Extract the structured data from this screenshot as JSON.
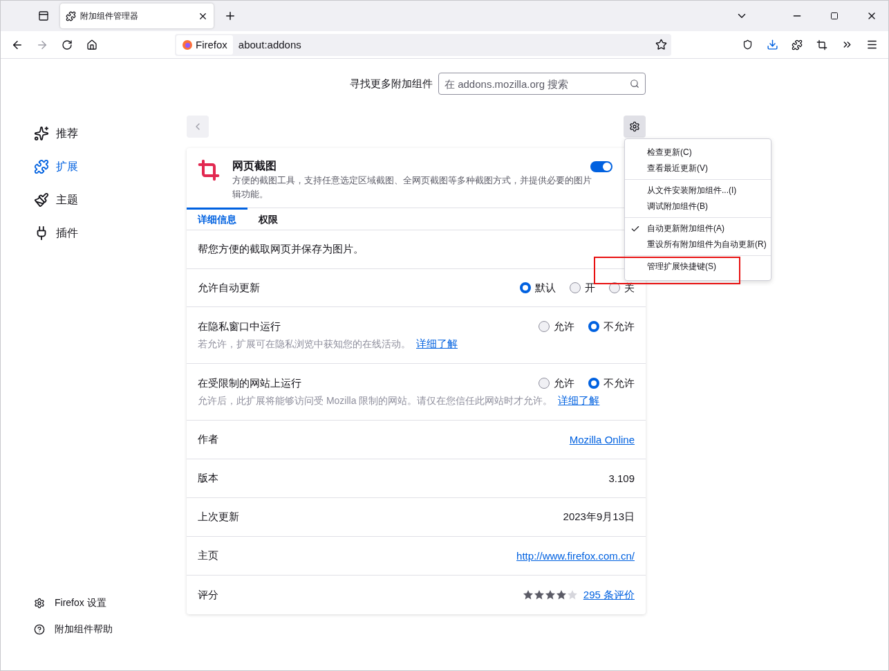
{
  "browser": {
    "tab_title": "附加组件管理器",
    "identity_label": "Firefox",
    "url": "about:addons"
  },
  "search": {
    "label": "寻找更多附加组件",
    "placeholder": "在 addons.mozilla.org 搜索"
  },
  "sidebar": {
    "items": [
      {
        "label": "推荐",
        "selected": false
      },
      {
        "label": "扩展",
        "selected": true
      },
      {
        "label": "主题",
        "selected": false
      },
      {
        "label": "插件",
        "selected": false
      }
    ],
    "footer": [
      "Firefox 设置",
      "附加组件帮助"
    ]
  },
  "addon": {
    "name": "网页截图",
    "enabled": true,
    "description_lines": [
      "方便的截图工具，支持任意选定区域截图、全网页截图等多种截图方式，并提供必要的图片",
      "辑功能。"
    ],
    "tabs": [
      {
        "label": "详细信息",
        "selected": true
      },
      {
        "label": "权限",
        "selected": false
      }
    ],
    "rows": [
      {
        "kind": "text",
        "text": "帮您方便的截取网页并保存为图片。"
      },
      {
        "kind": "radios",
        "label": "允许自动更新",
        "options": [
          {
            "label": "默认",
            "selected": true
          },
          {
            "label": "开",
            "selected": false
          },
          {
            "label": "关",
            "selected": false
          }
        ]
      },
      {
        "kind": "radios",
        "label": "在隐私窗口中运行",
        "note": "若允许，扩展可在隐私浏览中获知您的在线活动。",
        "link": "详细了解",
        "options": [
          {
            "label": "允许",
            "selected": false
          },
          {
            "label": "不允许",
            "selected": true
          }
        ]
      },
      {
        "kind": "radios",
        "label": "在受限制的网站上运行",
        "note": "允许后，此扩展将能够访问受 Mozilla 限制的网站。请仅在您信任此网站时才允许。",
        "link": "详细了解",
        "options": [
          {
            "label": "允许",
            "selected": false
          },
          {
            "label": "不允许",
            "selected": true
          }
        ]
      },
      {
        "kind": "link",
        "label": "作者",
        "value": "Mozilla Online"
      },
      {
        "kind": "info",
        "label": "版本",
        "value": "3.109"
      },
      {
        "kind": "info",
        "label": "上次更新",
        "value": "2023年9月13日"
      },
      {
        "kind": "link",
        "label": "主页",
        "value": "http://www.firefox.com.cn/"
      },
      {
        "kind": "rating",
        "label": "评分",
        "stars": 4,
        "value": "295 条评价"
      }
    ]
  },
  "menu": {
    "groups": [
      [
        {
          "label": "检查更新(C)",
          "checked": false
        },
        {
          "label": "查看最近更新(V)",
          "checked": false
        }
      ],
      [
        {
          "label": "从文件安装附加组件...(I)",
          "checked": false
        },
        {
          "label": "调试附加组件(B)",
          "checked": false
        }
      ],
      [
        {
          "label": "自动更新附加组件(A)",
          "checked": true
        },
        {
          "label": "重设所有附加组件为自动更新(R)",
          "checked": false
        }
      ],
      [
        {
          "label": "管理扩展快捷键(S)",
          "checked": false,
          "highlighted": true
        }
      ]
    ]
  }
}
